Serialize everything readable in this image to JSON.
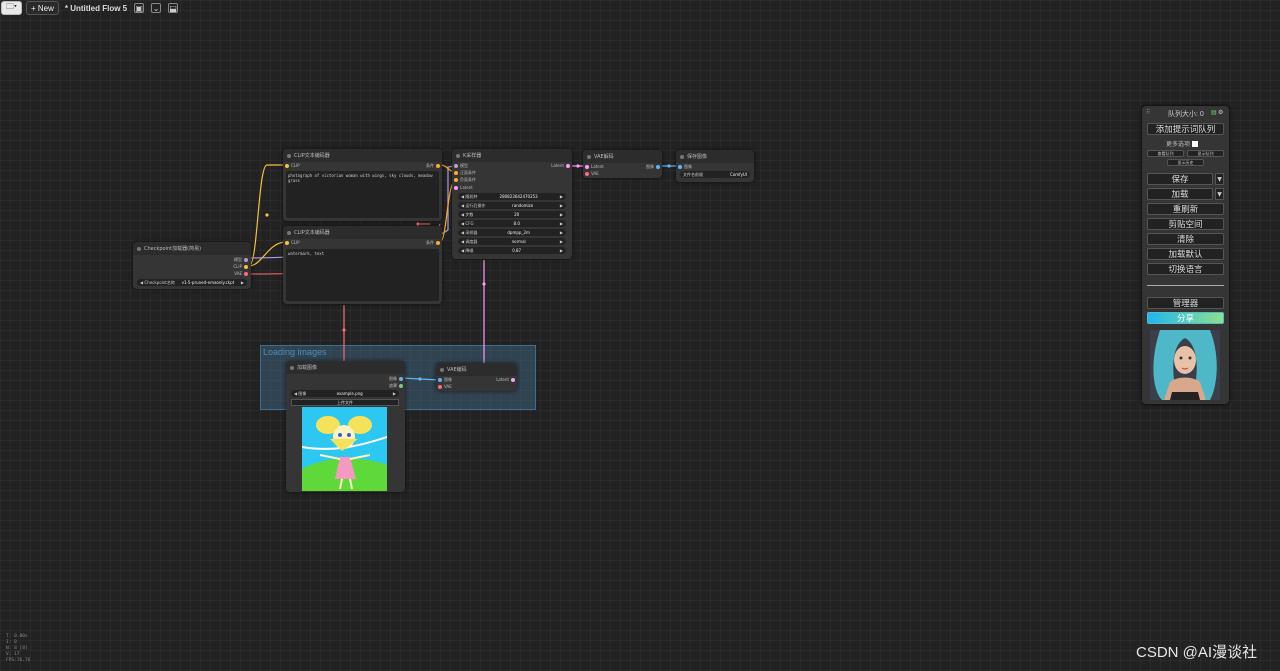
{
  "topbar": {
    "folder_glyph": "🗀▾",
    "new_label": "+ New",
    "flow_title": "* Untitled Flow 5",
    "icons": [
      "image-icon",
      "chevron-down-icon",
      "save-icon"
    ]
  },
  "group": {
    "title": "Loading images"
  },
  "nodes": {
    "checkpoint": {
      "title": "Checkpoint加载器(简易)",
      "outputs": [
        "模型",
        "CLIP",
        "VAE"
      ],
      "widget_label": "Checkpoint名称",
      "widget_value": "v1-5-pruned-emaonly.ckpt"
    },
    "clip_pos": {
      "title": "CLIP文本编码器",
      "input": "CLIP",
      "output": "条件",
      "text": "photograph of victorian woman with wings, sky clouds, meadow grass"
    },
    "clip_neg": {
      "title": "CLIP文本编码器",
      "input": "CLIP",
      "output": "条件",
      "text": "watermark, text"
    },
    "ksampler": {
      "title": "K采样器",
      "inputs": [
        "模型",
        "正面条件",
        "负面条件",
        "Latent"
      ],
      "output": "Latent",
      "widgets": [
        {
          "label": "随机种",
          "value": "280823642470253"
        },
        {
          "label": "运行后操作",
          "value": "randomize"
        },
        {
          "label": "步数",
          "value": "20"
        },
        {
          "label": "CFG",
          "value": "8.0"
        },
        {
          "label": "采样器",
          "value": "dpmpp_2m"
        },
        {
          "label": "调度器",
          "value": "normal"
        },
        {
          "label": "降噪",
          "value": "0.87"
        }
      ]
    },
    "vae_decode": {
      "title": "VAE解码",
      "inputs": [
        "Latent",
        "VAE"
      ],
      "output": "图像"
    },
    "save_image": {
      "title": "保存图像",
      "input": "图像",
      "widget_label": "文件名前缀",
      "widget_value": "ComfyUI"
    },
    "load_image": {
      "title": "加载图像",
      "outputs": [
        "图像",
        "遮罩"
      ],
      "widget_label": "图像",
      "widget_value": "example.png",
      "upload_label": "上传文件"
    },
    "vae_encode": {
      "title": "VAE编码",
      "inputs": [
        "图像",
        "VAE"
      ],
      "output": "Latent"
    }
  },
  "panel": {
    "queue_label": "队列大小: 0",
    "add_queue": "添加提示词队列",
    "more_options": "更多选项",
    "view_queue": "查看队列",
    "view_history": "显示队列",
    "view_history2": "显示历史",
    "save": "保存",
    "load": "加载",
    "refresh": "重刷新",
    "clipspace": "剪贴空间",
    "clear": "清除",
    "load_default": "加载默认",
    "switch_lang": "切换语言",
    "manager": "管理器",
    "share": "分享"
  },
  "stats": [
    "T: 0.00s",
    "I: 0",
    "N: 8 [8]",
    "V: 17",
    "FPS:76.76"
  ],
  "watermark": "CSDN @AI漫谈社",
  "colors": {
    "clip": "#f5c33b",
    "model": "#b39ddb",
    "vae": "#ff6e6e",
    "conditioning": "#ffa931",
    "latent": "#ff9cf9",
    "image": "#64b5f6"
  }
}
